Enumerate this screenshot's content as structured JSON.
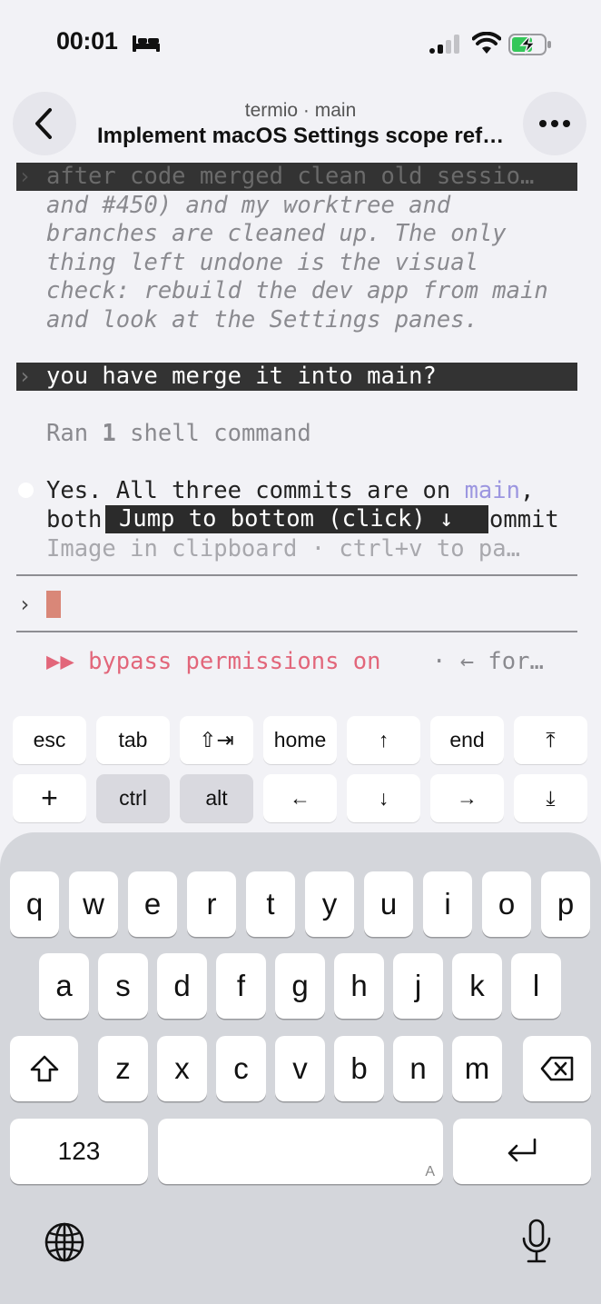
{
  "status_bar": {
    "time": "00:01"
  },
  "header": {
    "subtitle": "termio · main",
    "title": "Implement macOS Settings scope ref…"
  },
  "terminal": {
    "collapsed_prompt": "after code merged clean old sessio…",
    "reply_lines": [
      "and #450) and my worktree and",
      "branches are cleaned up. The only",
      "thing left undone is the visual",
      "check: rebuild the dev app from main",
      "and look at the Settings panes."
    ],
    "user_prompt": "you have merge it into main?",
    "ran_prefix": "Ran ",
    "ran_count": "1",
    "ran_suffix": " shell command",
    "answer_prefix": "Yes. All three commits are on ",
    "answer_link": "main",
    "answer_suffix": ",",
    "answer_line2_start": "both",
    "answer_line2_end": "ommit",
    "jump_to_bottom": "Jump to bottom (click) ↓",
    "clipboard_hint": "Image in clipboard · ctrl+v to pa…",
    "prompt_symbol": "›",
    "mode_icon": "▶▶",
    "mode_label": "bypass permissions on",
    "mode_hint": "· ← for…"
  },
  "accessory_keys": {
    "row1": [
      "esc",
      "tab",
      "⇧⇥",
      "home",
      "↑",
      "end",
      "⤒"
    ],
    "row2": [
      "+",
      "ctrl",
      "alt",
      "←",
      "↓",
      "→",
      "⤓"
    ]
  },
  "keyboard": {
    "row1": [
      "q",
      "w",
      "e",
      "r",
      "t",
      "y",
      "u",
      "i",
      "o",
      "p"
    ],
    "row2": [
      "a",
      "s",
      "d",
      "f",
      "g",
      "h",
      "j",
      "k",
      "l"
    ],
    "row3": [
      "z",
      "x",
      "c",
      "v",
      "b",
      "n",
      "m"
    ],
    "numbers_label": "123",
    "space_hint": "A"
  },
  "colors": {
    "accent_pink": "#e2667a",
    "link_purple": "#9c96e0",
    "cursor": "#d98778"
  }
}
